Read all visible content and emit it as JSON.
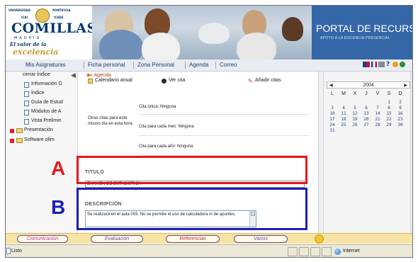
{
  "logo": {
    "top_left": "UNIVERSIDAD",
    "top_right": "PONTIFICIA",
    "seal_left": "ICAI",
    "seal_right": "ICADE",
    "name": "COMILLAS",
    "city": "MADRID",
    "tagline1": "El valor de la",
    "tagline2": "excelencia"
  },
  "portal": {
    "title": "PORTAL DE RECURSOS",
    "subtitle": "APOYO A LA DOCENCIA PRESENCIAL"
  },
  "menu": [
    "Mis Asignaturas",
    "Ficha personal",
    "Zona Personal",
    "Agenda",
    "Correo"
  ],
  "tree": {
    "header": "cerrar índice",
    "items": [
      {
        "label": "Información G",
        "type": "doc"
      },
      {
        "label": "Índice",
        "type": "doc"
      },
      {
        "label": "Guía de Estud",
        "type": "doc"
      },
      {
        "label": "Módulos de A",
        "type": "doc"
      },
      {
        "label": "Vista Prelimin",
        "type": "doc"
      },
      {
        "label": "Presentación",
        "type": "folder"
      },
      {
        "label": "Software ofim",
        "type": "folder"
      }
    ]
  },
  "agenda": {
    "breadcrumb": "Agenda",
    "toolbar": [
      "Calendario anual",
      "Ver cita",
      "Añadir citas"
    ],
    "other_label": "Otras citas para este mismo día en esta hora",
    "citas": [
      "Cita única: Ninguna",
      "Cita para cada mes: Ninguna",
      "Cita para cada año: Ninguna"
    ],
    "titulo_label": "TITULO",
    "titulo_value": "EXAMEN DE ESTADÍSTICA",
    "descripcion_label": "DESCRIPCION",
    "descripcion_value": "Se realizará en el aula 003. No se permite el uso de calculadora ni de apuntes."
  },
  "annotations": {
    "a": "A",
    "b": "B"
  },
  "calendar": {
    "year": "2004",
    "dow": [
      "L",
      "M",
      "X",
      "J",
      "V",
      "S",
      "D"
    ],
    "weeks": [
      [
        "",
        "",
        "",
        "",
        "",
        "1",
        "2"
      ],
      [
        "3",
        "4",
        "5",
        "6",
        "7",
        "8",
        "9"
      ],
      [
        "10",
        "11",
        "12",
        "13",
        "14",
        "15",
        "16"
      ],
      [
        "17",
        "18",
        "19",
        "20",
        "21",
        "22",
        "23"
      ],
      [
        "24",
        "25",
        "26",
        "27",
        "28",
        "29",
        "30"
      ],
      [
        "31",
        "",
        "",
        "",
        "",
        "",
        ""
      ]
    ]
  },
  "tabs": [
    {
      "label": "Comunicación",
      "color": "#c13a9a"
    },
    {
      "label": "Evaluación",
      "color": "#6b4aa8"
    },
    {
      "label": "Referencias",
      "color": "#c6282d"
    },
    {
      "label": "Varios",
      "color": "#6b4aa8"
    }
  ],
  "status": {
    "text": "Listo",
    "zone": "Internet"
  },
  "colors": {
    "annotation_a": "#e8161b",
    "annotation_b": "#1d1db3",
    "portal_bg": "#3567a8"
  }
}
